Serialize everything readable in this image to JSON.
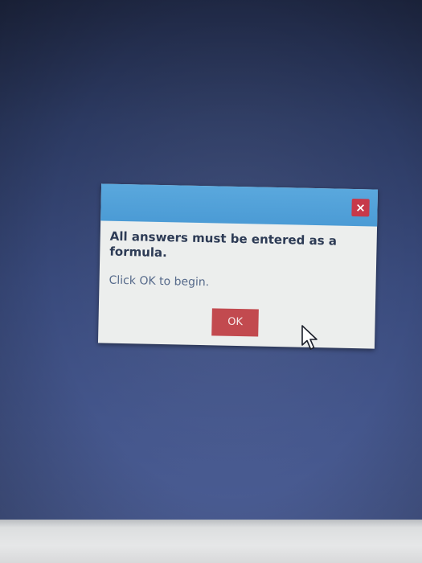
{
  "dialog": {
    "close_label": "×",
    "message": "All answers must be entered as a formula.",
    "instruction": "Click OK to begin.",
    "ok_label": "OK"
  },
  "colors": {
    "desktop": "#394a7c",
    "titlebar": "#4b9bd5",
    "dialog_body": "#eceeed",
    "close_button": "#c7394a",
    "ok_button": "#c24a4f",
    "message_text": "#2d3b55"
  },
  "icons": {
    "close": "close-icon",
    "cursor": "mouse-pointer-icon"
  }
}
